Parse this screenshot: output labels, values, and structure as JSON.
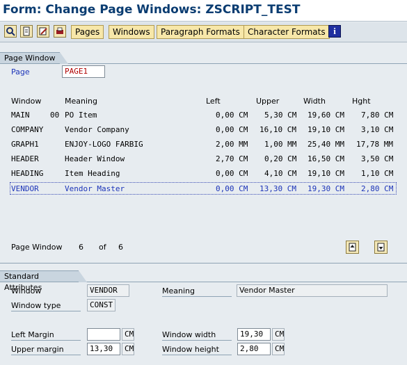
{
  "title": "Form: Change Page Windows: ZSCRIPT_TEST",
  "toolbar": {
    "icons": [
      "search-icon",
      "document-icon",
      "edit-icon",
      "print-icon"
    ],
    "buttons": [
      "Pages",
      "Windows",
      "Paragraph Formats",
      "Character Formats"
    ],
    "info_icon": "i"
  },
  "page_window_group": {
    "title": "Page Window",
    "page_label": "Page",
    "page_value": "PAGE1"
  },
  "table": {
    "headers": [
      "Window",
      "Meaning",
      "Left",
      "Upper",
      "Width",
      "Hght"
    ],
    "rows": [
      {
        "window": "MAIN",
        "num": "00",
        "meaning": "PO Item",
        "left": "0,00 CM",
        "upper": "5,30 CM",
        "width": "19,60 CM",
        "height": "7,80 CM"
      },
      {
        "window": "COMPANY",
        "num": "",
        "meaning": "Vendor Company",
        "left": "0,00 CM",
        "upper": "16,10 CM",
        "width": "19,10 CM",
        "height": "3,10 CM"
      },
      {
        "window": "GRAPH1",
        "num": "",
        "meaning": "ENJOY-LOGO FARBIG",
        "left": "2,00 MM",
        "upper": "1,00 MM",
        "width": "25,40 MM",
        "height": "17,78 MM"
      },
      {
        "window": "HEADER",
        "num": "",
        "meaning": "Header Window",
        "left": "2,70 CM",
        "upper": "0,20 CM",
        "width": "16,50 CM",
        "height": "3,50 CM"
      },
      {
        "window": "HEADING",
        "num": "",
        "meaning": "Item Heading",
        "left": "0,00 CM",
        "upper": "4,10 CM",
        "width": "19,10 CM",
        "height": "1,10 CM"
      },
      {
        "window": "VENDOR",
        "num": "",
        "meaning": "Vendor Master",
        "left": "0,00 CM",
        "upper": "13,30 CM",
        "width": "19,30 CM",
        "height": "2,80 CM"
      }
    ]
  },
  "pager": {
    "label": "Page Window",
    "current": "6",
    "of_label": "of",
    "total": "6"
  },
  "standard_attributes": {
    "title": "Standard Attributes",
    "window_label": "Window",
    "window_value": "VENDOR",
    "meaning_label": "Meaning",
    "meaning_value": "Vendor Master",
    "window_type_label": "Window type",
    "window_type_value": "CONST",
    "left_margin_label": "Left Margin",
    "left_margin_value": "",
    "left_margin_unit": "CM",
    "upper_margin_label": "Upper margin",
    "upper_margin_value": "13,30",
    "upper_margin_unit": "CM",
    "window_width_label": "Window width",
    "window_width_value": "19,30",
    "window_width_unit": "CM",
    "window_height_label": "Window height",
    "window_height_value": "2,80",
    "window_height_unit": "CM"
  }
}
